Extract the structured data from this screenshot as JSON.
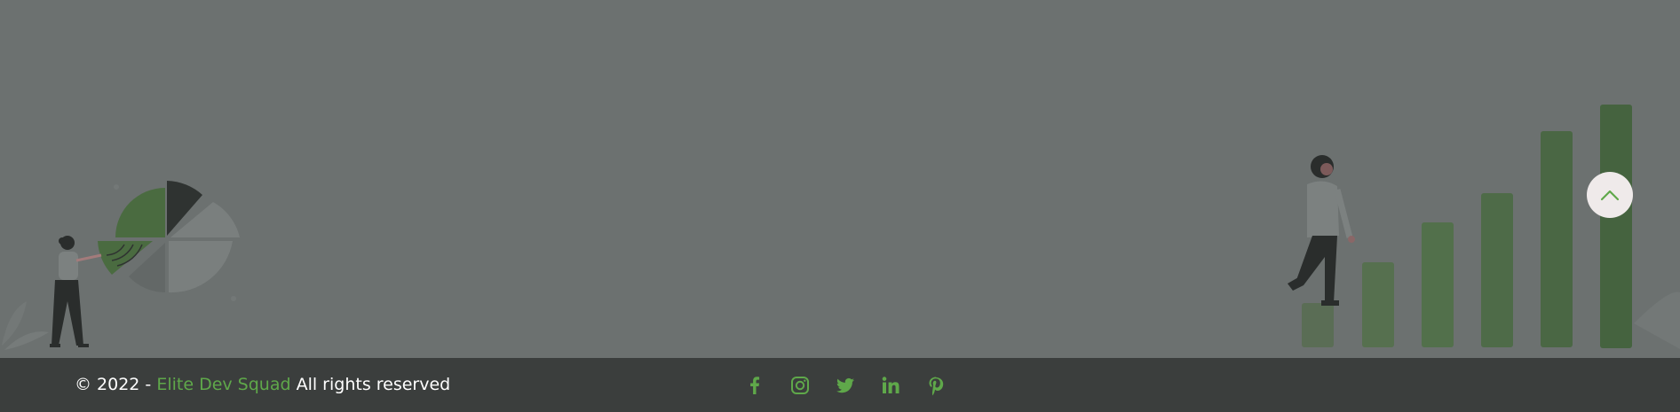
{
  "footer": {
    "copyright_prefix": "© 2022 - ",
    "brand_name": "Elite Dev Squad",
    "copyright_suffix": " All rights reserved"
  },
  "social": [
    {
      "name": "facebook-icon"
    },
    {
      "name": "instagram-icon"
    },
    {
      "name": "twitter-icon"
    },
    {
      "name": "linkedin-icon"
    },
    {
      "name": "pinterest-icon"
    }
  ],
  "scroll_top": {
    "icon": "chevron-up-icon"
  },
  "colors": {
    "background": "#6c7170",
    "footer": "#3b3e3d",
    "accent": "#5fa84a",
    "bars": "#4e6b48"
  }
}
